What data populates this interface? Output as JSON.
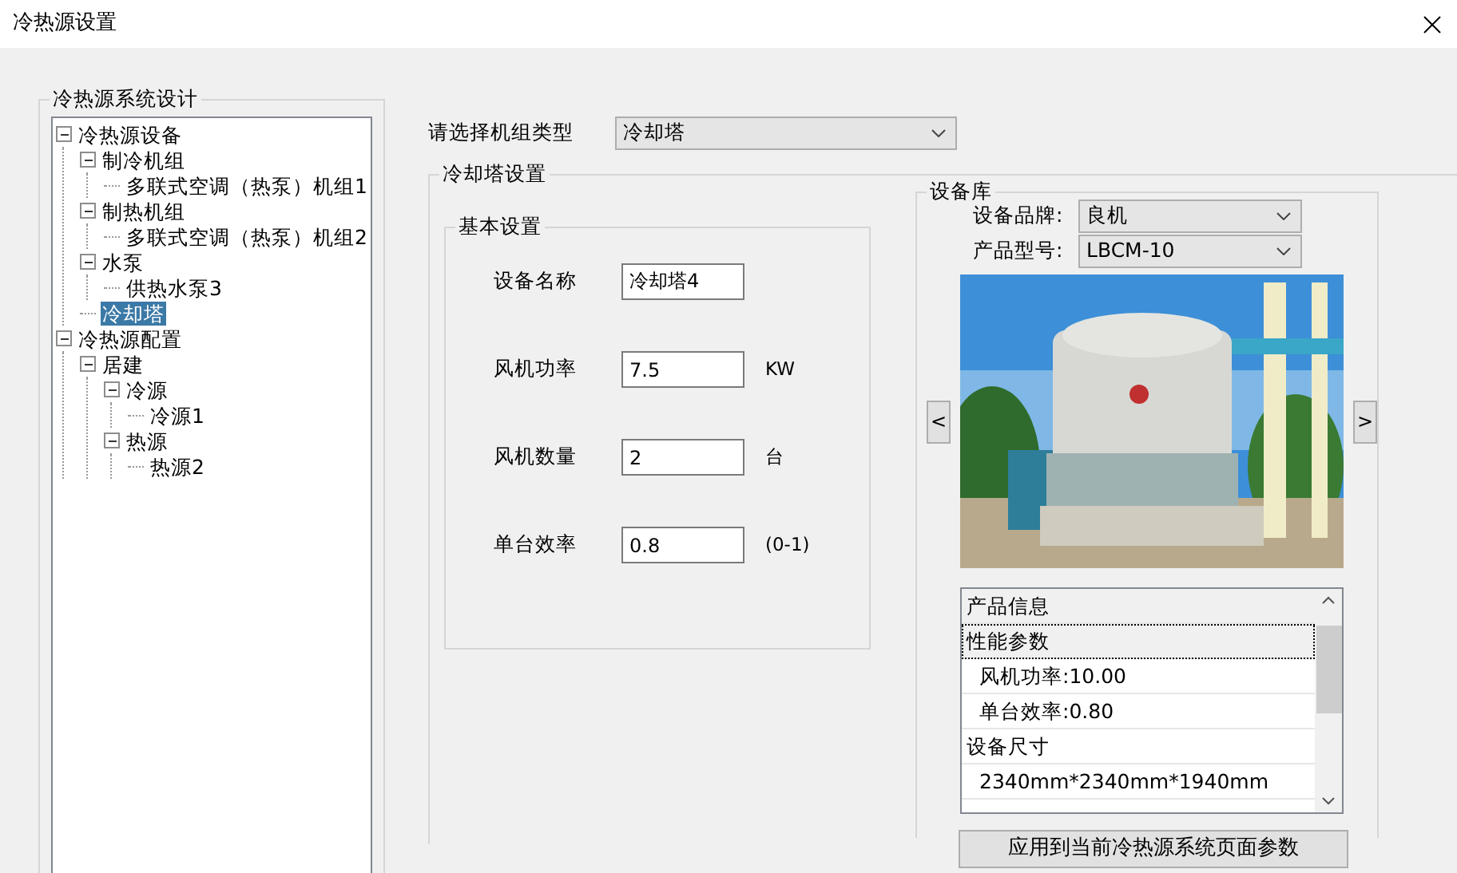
{
  "window": {
    "title": "冷热源设置"
  },
  "tree": {
    "title": "冷热源系统设计",
    "items": [
      {
        "label": "冷热源设备",
        "expanded": true,
        "selected": false,
        "children": [
          {
            "label": "制冷机组",
            "expanded": true,
            "selected": false,
            "children": [
              {
                "label": "多联式空调（热泵）机组1",
                "selected": false
              }
            ]
          },
          {
            "label": "制热机组",
            "expanded": true,
            "selected": false,
            "children": [
              {
                "label": "多联式空调（热泵）机组2",
                "selected": false
              }
            ]
          },
          {
            "label": "水泵",
            "expanded": true,
            "selected": false,
            "children": [
              {
                "label": "供热水泵3",
                "selected": false
              }
            ]
          },
          {
            "label": "冷却塔",
            "selected": true
          }
        ]
      },
      {
        "label": "冷热源配置",
        "expanded": true,
        "selected": false,
        "children": [
          {
            "label": "居建",
            "expanded": true,
            "selected": false,
            "children": [
              {
                "label": "冷源",
                "expanded": true,
                "selected": false,
                "children": [
                  {
                    "label": "冷源1",
                    "selected": false
                  }
                ]
              },
              {
                "label": "热源",
                "expanded": true,
                "selected": false,
                "children": [
                  {
                    "label": "热源2",
                    "selected": false
                  }
                ]
              }
            ]
          }
        ]
      }
    ]
  },
  "unit_type": {
    "label": "请选择机组类型",
    "value": "冷却塔"
  },
  "settings": {
    "title": "冷却塔设置",
    "basic": {
      "title": "基本设置",
      "fields": [
        {
          "label": "设备名称",
          "value": "冷却塔4"
        },
        {
          "label": "风机功率",
          "value": "7.5",
          "unit": "KW"
        },
        {
          "label": "风机数量",
          "value": "2",
          "unit": "台"
        },
        {
          "label": "单台效率",
          "value": "0.8",
          "unit": "(0-1)"
        }
      ]
    }
  },
  "library": {
    "title": "设备库",
    "brand": {
      "label": "设备品牌:",
      "value": "良机"
    },
    "model": {
      "label": "产品型号:",
      "value": "LBCM-10"
    },
    "prev": "<",
    "next": ">",
    "info": [
      {
        "kind": "header",
        "text": "产品信息",
        "selected": false
      },
      {
        "kind": "group",
        "text": "性能参数",
        "selected": true
      },
      {
        "kind": "item",
        "text": "风机功率:10.00",
        "selected": false
      },
      {
        "kind": "item",
        "text": "单台效率:0.80",
        "selected": false
      },
      {
        "kind": "group",
        "text": "设备尺寸",
        "selected": false
      },
      {
        "kind": "item",
        "text": "2340mm*2340mm*1940mm",
        "selected": false
      }
    ],
    "apply_button": "应用到当前冷热源系统页面参数"
  }
}
